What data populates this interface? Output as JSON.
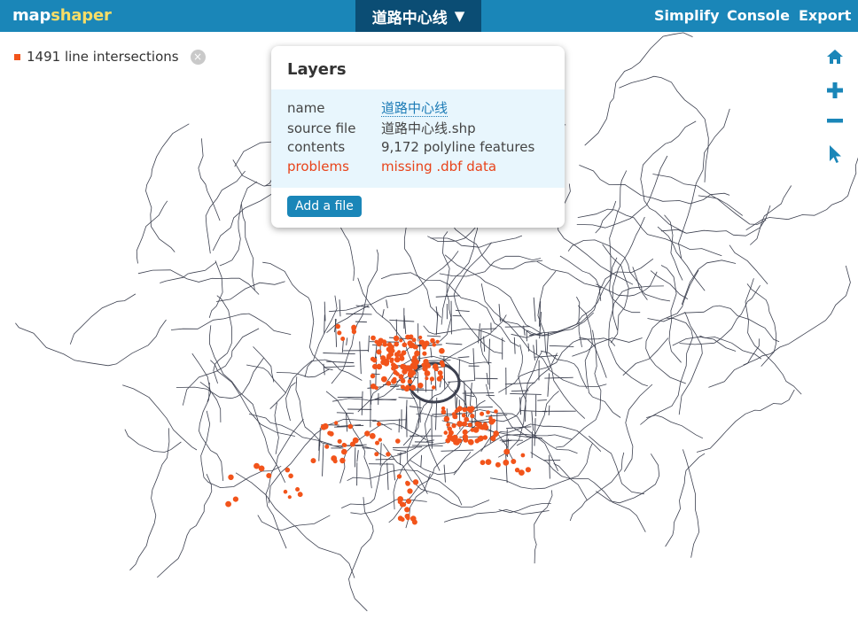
{
  "app": {
    "logo_a": "map",
    "logo_b": "shaper"
  },
  "header": {
    "layer_name": "道路中心线",
    "layer_caret": "▼",
    "menu": {
      "simplify": "Simplify",
      "console": "Console",
      "export": "Export"
    }
  },
  "legend": {
    "label": "1491 line intersections",
    "close": "×",
    "swatch_color": "#f2541b"
  },
  "layers_popup": {
    "title": "Layers",
    "rows": [
      {
        "key": "name",
        "value": "道路中心线"
      },
      {
        "key": "source file",
        "value": "道路中心线.shp"
      },
      {
        "key": "contents",
        "value": "9,172 polyline features"
      },
      {
        "key": "problems",
        "value": "missing .dbf data"
      }
    ],
    "add_button": "Add a file"
  },
  "tools": [
    "home-icon",
    "zoom-in-icon",
    "zoom-out-icon",
    "pointer-icon"
  ],
  "colors": {
    "accent": "#1a86b8",
    "dark_accent": "#0b4d74",
    "roads": "#3d4150",
    "intersections": "#f2541b",
    "problem_text": "#e8431a"
  }
}
